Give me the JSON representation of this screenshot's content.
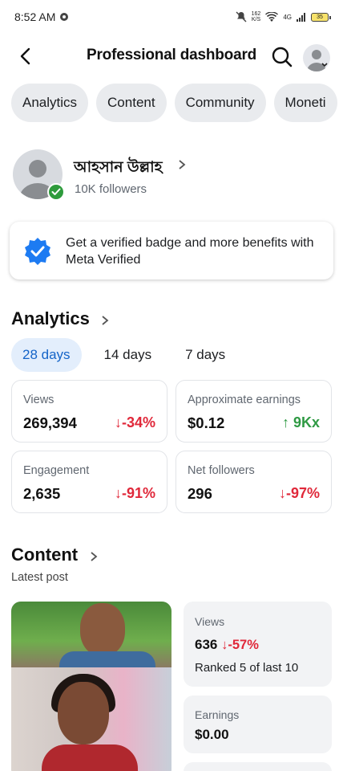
{
  "status_bar": {
    "time": "8:52 AM",
    "net_speed_top": "162",
    "net_speed_unit": "K/S",
    "network_type": "4G",
    "battery": "35"
  },
  "header": {
    "title": "Professional dashboard"
  },
  "tabs": [
    {
      "label": "Analytics"
    },
    {
      "label": "Content"
    },
    {
      "label": "Community"
    },
    {
      "label": "Moneti"
    }
  ],
  "profile": {
    "name": "আহসান উল্লাহ",
    "followers": "10K followers"
  },
  "meta_verified": {
    "text": "Get a verified badge and more benefits with Meta Verified"
  },
  "analytics": {
    "title": "Analytics",
    "day_options": [
      {
        "label": "28 days",
        "selected": true
      },
      {
        "label": "14 days",
        "selected": false
      },
      {
        "label": "7 days",
        "selected": false
      }
    ],
    "stats": [
      {
        "label": "Views",
        "value": "269,394",
        "change": "-34%",
        "direction": "down"
      },
      {
        "label": "Approximate earnings",
        "value": "$0.12",
        "change": "9Kx",
        "direction": "up"
      },
      {
        "label": "Engagement",
        "value": "2,635",
        "change": "-91%",
        "direction": "down"
      },
      {
        "label": "Net followers",
        "value": "296",
        "change": "-97%",
        "direction": "down"
      }
    ]
  },
  "content": {
    "title": "Content",
    "subtitle": "Latest post",
    "latest": {
      "views_label": "Views",
      "views_value": "636",
      "views_change": "-57%",
      "ranked": "Ranked 5 of last 10",
      "earnings_label": "Earnings",
      "earnings_value": "$0.00"
    }
  },
  "colors": {
    "negative": "#e0283a",
    "positive": "#2f9a44",
    "accent": "#1464c8",
    "verified_green": "#2e9b3c",
    "meta_blue": "#1d7bf2"
  }
}
